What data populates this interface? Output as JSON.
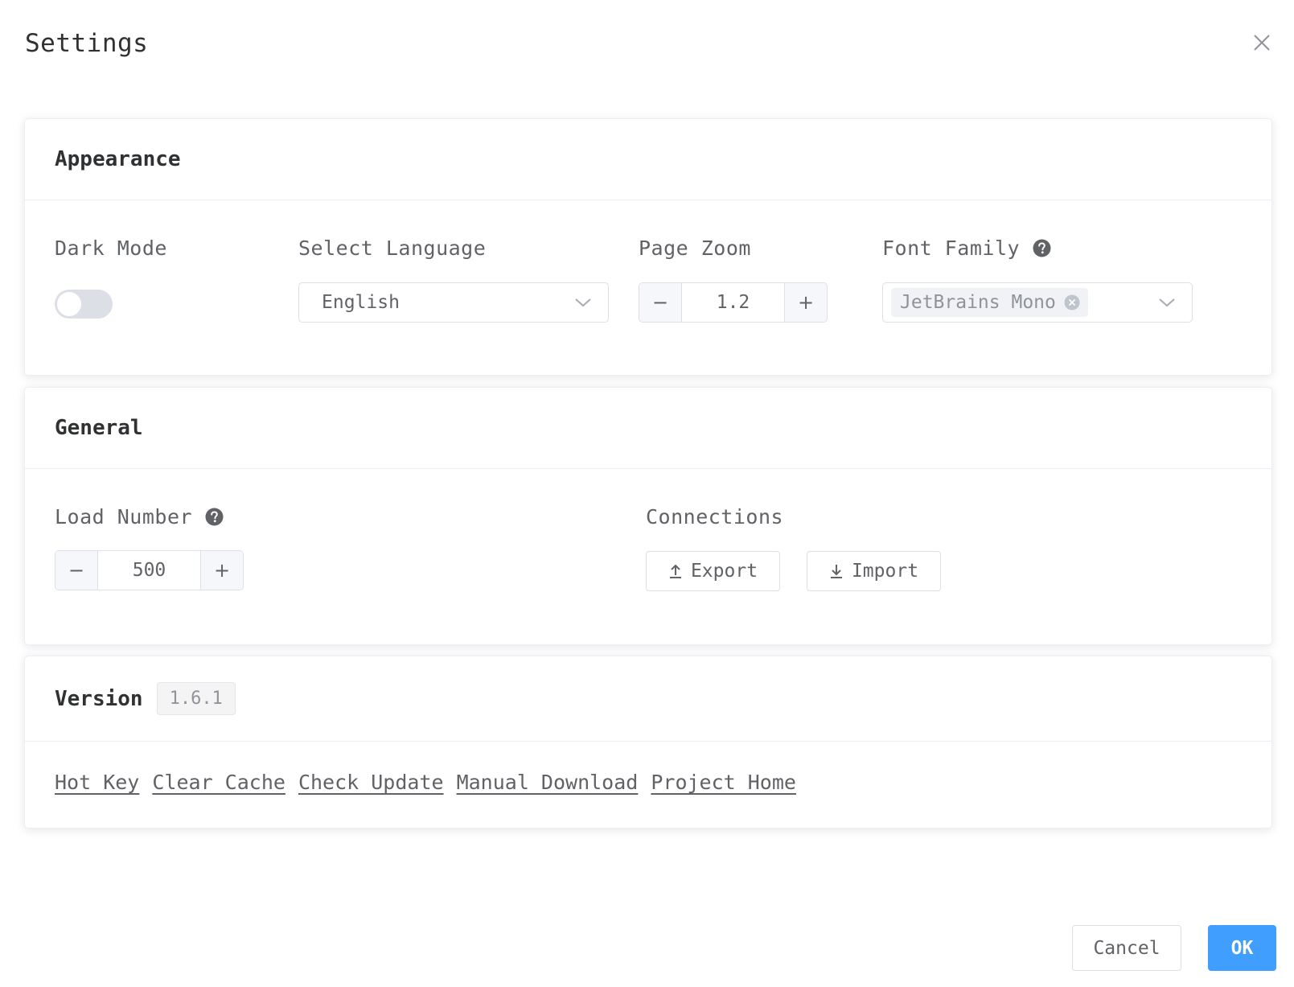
{
  "dialog": {
    "title": "Settings"
  },
  "appearance": {
    "header": "Appearance",
    "dark_mode": {
      "label": "Dark Mode",
      "enabled": false
    },
    "language": {
      "label": "Select Language",
      "value": "English"
    },
    "page_zoom": {
      "label": "Page Zoom",
      "value": "1.2",
      "minus": "−",
      "plus": "+"
    },
    "font_family": {
      "label": "Font Family",
      "selected": "JetBrains Mono",
      "help_icon": "question-circle-icon"
    }
  },
  "general": {
    "header": "General",
    "load_number": {
      "label": "Load Number",
      "value": "500",
      "minus": "−",
      "plus": "+",
      "help_icon": "question-circle-icon"
    },
    "connections": {
      "label": "Connections",
      "export_label": "Export",
      "import_label": "Import"
    }
  },
  "version": {
    "header": "Version",
    "number": "1.6.1",
    "links": [
      "Hot Key",
      "Clear Cache",
      "Check Update",
      "Manual Download",
      "Project Home"
    ]
  },
  "footer": {
    "cancel_label": "Cancel",
    "ok_label": "OK"
  },
  "colors": {
    "primary": "#409eff",
    "text": "#303133",
    "secondary_text": "#606266",
    "border": "#dcdfe6"
  }
}
